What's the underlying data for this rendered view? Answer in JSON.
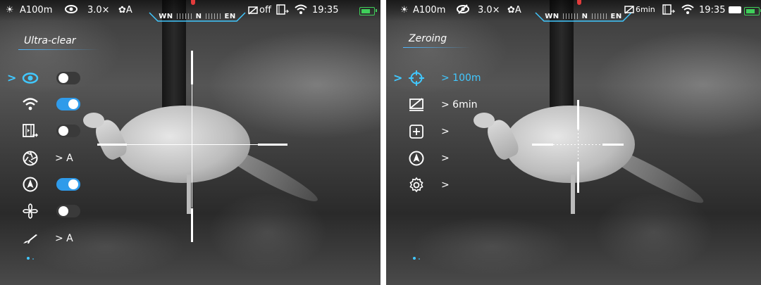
{
  "colors": {
    "accent": "#41c8ff",
    "toggle_on": "#2f9bea",
    "battery": "#3fcf5a",
    "north_marker": "#e23b3b"
  },
  "left_screen": {
    "status_bar": {
      "sun_icon": "sun-icon",
      "range": "A100m",
      "mode_icon": "eye-icon",
      "zoom": "3.0×",
      "calibration": "A",
      "compass": {
        "west": "WN",
        "north": "N",
        "east": "EN"
      },
      "standby_timer": "off",
      "clock": "19:35",
      "wifi_icon": "wifi-icon",
      "battery_icon": "battery-icon"
    },
    "menu_title": "Ultra-clear",
    "selected_indicator": ">",
    "items": [
      {
        "icon": "eye-icon",
        "toggle": "on-accent-off"
      },
      {
        "icon": "wifi-icon",
        "toggle": "on"
      },
      {
        "icon": "video-record-icon",
        "toggle": "off"
      },
      {
        "icon": "aperture-icon",
        "value": "> A"
      },
      {
        "icon": "compass-icon",
        "toggle": "on"
      },
      {
        "icon": "propeller-icon",
        "toggle": "off"
      },
      {
        "icon": "rifle-icon",
        "value": "> A"
      }
    ]
  },
  "right_screen": {
    "status_bar": {
      "sun_icon": "sun-icon",
      "range": "A100m",
      "mode_icon": "eye-off-icon",
      "zoom": "3.0×",
      "calibration": "A",
      "compass": {
        "west": "WN",
        "north": "N",
        "east": "EN"
      },
      "standby_timer": "6min",
      "clock": "19:35",
      "wifi_icon": "wifi-icon",
      "battery_icon": "battery-icon"
    },
    "menu_title": "Zeroing",
    "selected_indicator": ">",
    "items": [
      {
        "icon": "crosshair-target-icon",
        "value": "> 100m"
      },
      {
        "icon": "screen-off-icon",
        "value": "> 6min"
      },
      {
        "icon": "add-box-icon",
        "value": ">"
      },
      {
        "icon": "compass-icon",
        "value": ">"
      },
      {
        "icon": "settings-gear-icon",
        "value": ">"
      }
    ]
  }
}
